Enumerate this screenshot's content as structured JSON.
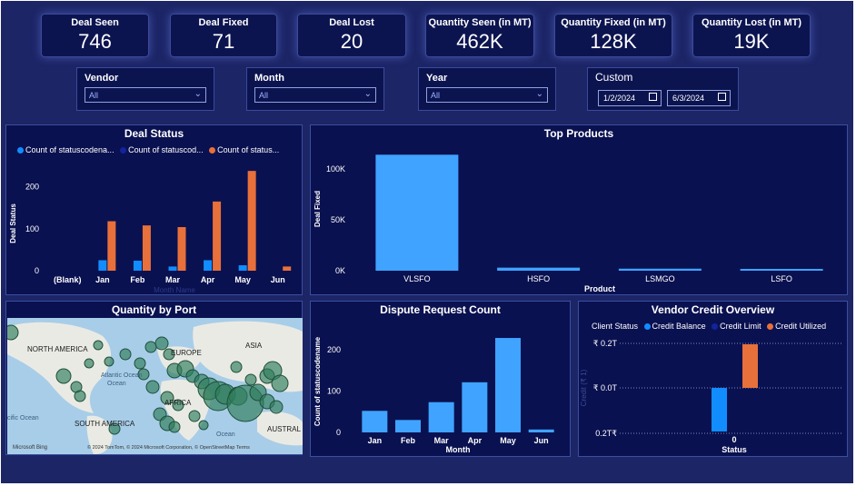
{
  "kpis": [
    {
      "label": "Deal Seen",
      "value": "746"
    },
    {
      "label": "Deal Fixed",
      "value": "71"
    },
    {
      "label": "Deal Lost",
      "value": "20"
    },
    {
      "label": "Quantity Seen (in MT)",
      "value": "462K"
    },
    {
      "label": "Quantity Fixed (in MT)",
      "value": "128K"
    },
    {
      "label": "Quantity Lost (in MT)",
      "value": "19K"
    }
  ],
  "filters": {
    "vendor": {
      "label": "Vendor",
      "value": "All"
    },
    "month": {
      "label": "Month",
      "value": "All"
    },
    "year": {
      "label": "Year",
      "value": "All"
    },
    "custom": {
      "label": "Custom",
      "start": "1/2/2024",
      "end": "6/3/2024"
    }
  },
  "colors": {
    "orange": "#e8703a",
    "blue": "#118dff",
    "light_blue": "#3fa3ff",
    "dark_blue": "#12239e",
    "accent": "#e8703a"
  },
  "map": {
    "title": "Quantity by Port",
    "labels": [
      "NORTH AMERICA",
      "EUROPE",
      "ASIA",
      "Atlantic Ocean",
      "AFRICA",
      "SOUTH AMERICA",
      "AUSTRAL",
      "cific Ocean",
      "Ocean"
    ],
    "attribution": "© 2024 TomTom, © 2024 Microsoft Corporation, © OpenStreetMap  Terms",
    "logo": "Microsoft Bing"
  },
  "chart_data": [
    {
      "type": "bar",
      "title": "Deal Status",
      "xlabel": "Month Name",
      "ylabel": "Deal Status",
      "categories": [
        "(Blank)",
        "Jan",
        "Feb",
        "Mar",
        "Apr",
        "May",
        "Jun"
      ],
      "series": [
        {
          "name": "Count of statuscodena...",
          "values": [
            0,
            0,
            0,
            0,
            0,
            0,
            0
          ]
        },
        {
          "name": "Count of statuscod...",
          "values": [
            0,
            25,
            24,
            10,
            25,
            13,
            0
          ]
        },
        {
          "name": "Count of status...",
          "values": [
            0,
            118,
            108,
            104,
            165,
            238,
            10
          ]
        }
      ],
      "yticks": [
        0,
        100,
        200
      ],
      "ylim": [
        0,
        260
      ]
    },
    {
      "type": "bar",
      "title": "Top Products",
      "xlabel": "Product",
      "ylabel": "Deal Fixed",
      "categories": [
        "VLSFO",
        "HSFO",
        "LSMGO",
        "LSFO"
      ],
      "values": [
        114000,
        3000,
        2000,
        500
      ],
      "yticks": [
        0,
        50000,
        100000
      ],
      "ytick_labels": [
        "0K",
        "50K",
        "100K"
      ],
      "ylim": [
        0,
        125000
      ]
    },
    {
      "type": "bar",
      "title": "Dispute Request Count",
      "xlabel": "Month",
      "ylabel": "Count of statuscodename",
      "categories": [
        "Jan",
        "Feb",
        "Mar",
        "Apr",
        "May",
        "Jun"
      ],
      "values": [
        52,
        30,
        73,
        121,
        228,
        7
      ],
      "yticks": [
        0,
        100,
        200
      ],
      "ylim": [
        0,
        250
      ]
    },
    {
      "type": "bar",
      "title": "Vendor Credit Overview",
      "legend_title": "Client Status",
      "xlabel": "Status",
      "ylabel": "Credit (₹ 1)",
      "categories": [
        "0"
      ],
      "series": [
        {
          "name": "Credit Balance",
          "start": 0.0,
          "end": -1.0
        },
        {
          "name": "Credit Limit",
          "start": 0.0,
          "end": 0.0
        },
        {
          "name": "Credit Utilized",
          "start": 0.0,
          "end": 1.0
        }
      ],
      "ytick_labels": [
        "₹ 0.2T",
        "₹ 0.0T",
        "0.2T₹"
      ]
    }
  ]
}
